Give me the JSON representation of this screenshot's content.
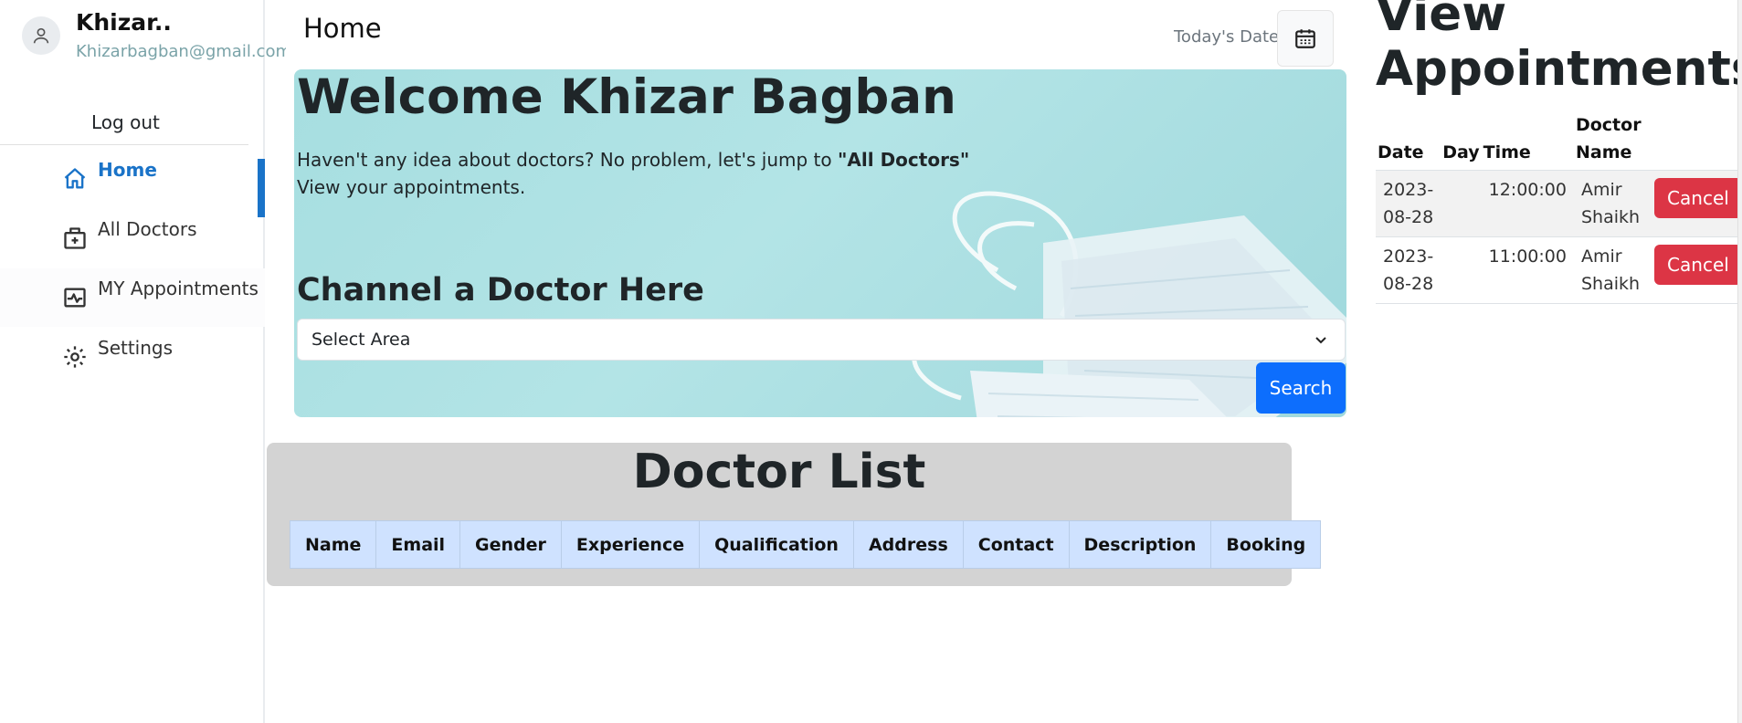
{
  "user": {
    "name": "Khizar..",
    "email": "Khizarbagban@gmail.com",
    "logout_label": "Log out"
  },
  "sidebar": {
    "items": [
      {
        "label": "Home",
        "icon": "home-icon",
        "active": true
      },
      {
        "label": "All Doctors",
        "icon": "hospital-icon",
        "active": false
      },
      {
        "label": "MY Appointments",
        "icon": "heartbeat-icon",
        "active": false
      },
      {
        "label": "Settings",
        "icon": "gear-icon",
        "active": false
      }
    ]
  },
  "header": {
    "title": "Home",
    "date_label": "Today's Date"
  },
  "banner": {
    "welcome": "Welcome Khizar Bagban",
    "line1_prefix": "Haven't any idea about doctors? No problem, let's jump to ",
    "line1_bold": "\"All Doctors\"",
    "line2": "View your appointments.",
    "channel_title": "Channel a Doctor Here",
    "select_value": "Select Area",
    "search_label": "Search"
  },
  "doctor_list": {
    "title": "Doctor List",
    "columns": [
      "Name",
      "Email",
      "Gender",
      "Experience",
      "Qualification",
      "Address",
      "Contact",
      "Description",
      "Booking"
    ]
  },
  "appointments": {
    "title": "View Appointments",
    "columns": {
      "date": "Date",
      "day": "Day",
      "time": "Time",
      "doctor": "Doctor Name"
    },
    "rows": [
      {
        "date": "2023-08-28",
        "day": "",
        "time": "12:00:00",
        "doctor": "Amir Shaikh",
        "action": "Cancel"
      },
      {
        "date": "2023-08-28",
        "day": "",
        "time": "11:00:00",
        "doctor": "Amir Shaikh",
        "action": "Cancel"
      }
    ]
  },
  "colors": {
    "primary": "#0d6efd",
    "danger": "#dc3545",
    "active_nav": "#1a73c8",
    "banner_bg": "#a6dee0",
    "table_header_bg": "#cfe2ff",
    "panel_bg": "#d3d3d3"
  }
}
